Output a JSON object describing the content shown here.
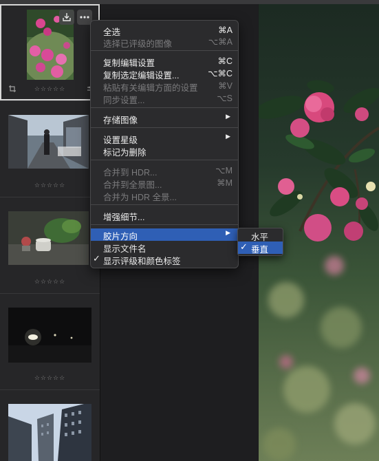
{
  "filmstrip": {
    "stars": "☆☆☆☆☆",
    "thumbnails": [
      "camellia-flowers",
      "street-man-walking",
      "stone-bowl-plants",
      "night-lights",
      "buildings-sky"
    ]
  },
  "menu": {
    "items": [
      {
        "label": "全选",
        "shortcut": "⌘A"
      },
      {
        "label": "选择已评级的图像",
        "shortcut": "⌥⌘A"
      },
      {
        "label": "复制编辑设置",
        "shortcut": "⌘C"
      },
      {
        "label": "复制选定编辑设置...",
        "shortcut": "⌥⌘C"
      },
      {
        "label": "粘贴有关编辑方面的设置",
        "shortcut": "⌘V"
      },
      {
        "label": "同步设置...",
        "shortcut": "⌥S"
      },
      {
        "label": "存储图像",
        "shortcut": "▶"
      },
      {
        "label": "设置星级",
        "shortcut": "▶"
      },
      {
        "label": "标记为删除",
        "shortcut": ""
      },
      {
        "label": "合并到 HDR...",
        "shortcut": "⌥M"
      },
      {
        "label": "合并到全景图...",
        "shortcut": "⌘M"
      },
      {
        "label": "合并为 HDR 全景...",
        "shortcut": ""
      },
      {
        "label": "增强细节...",
        "shortcut": ""
      },
      {
        "label": "胶片方向",
        "shortcut": "▶"
      },
      {
        "label": "显示文件名",
        "shortcut": ""
      },
      {
        "label": "显示评级和颜色标签",
        "shortcut": "",
        "checked": "✓"
      }
    ]
  },
  "submenu": {
    "items": [
      {
        "label": "水平"
      },
      {
        "label": "垂直",
        "checked": "✓"
      }
    ]
  },
  "colors": {
    "highlight": "#2f5fb5",
    "menu_bg": "#2b2b2d",
    "disabled_text": "#7b7b7d"
  }
}
